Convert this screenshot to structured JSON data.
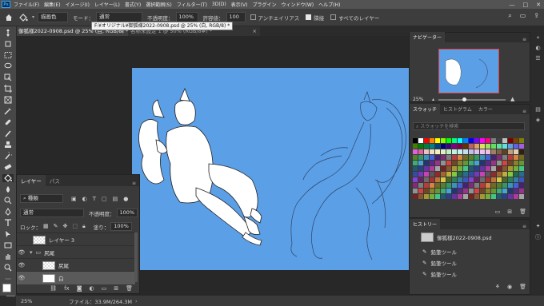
{
  "menu": {
    "app_badge": "Ps",
    "items": [
      "ファイル(F)",
      "編集(E)",
      "イメージ(I)",
      "レイヤー(L)",
      "書式(Y)",
      "選択範囲(S)",
      "フィルター(T)",
      "3D(D)",
      "表示(V)",
      "プラグイン",
      "ウィンドウ(W)",
      "ヘルプ(H)"
    ]
  },
  "options": {
    "fill_source": "描画色",
    "mode_label": "モード：",
    "mode_value": "通常",
    "opacity_label": "不透明度：",
    "opacity_value": "100%",
    "tolerance_label": "許容値：",
    "tolerance_value": "100",
    "antialias_label": "アンチエイリアス",
    "antialias_checked": false,
    "contiguous_label": "隣接",
    "contiguous_checked": true,
    "all_layers_label": "すべてのレイヤー",
    "all_layers_checked": false
  },
  "tabs": [
    {
      "label": "御狐様2022-0908.psd @ 25% (白, RGB/8) *",
      "active": true
    },
    {
      "label": "名称未設定 1 @ 50% (RGB/8#) *",
      "active": false
    }
  ],
  "tooltip": "F:¥オリジナル¥御狐様2022-0908.psd @ 25% (白, RGB/8) *",
  "layers_panel": {
    "tabs": [
      "レイヤー",
      "パス"
    ],
    "filter_label": "種類",
    "blend_mode": "通常",
    "opacity_label": "不透明度：",
    "opacity_value": "100%",
    "lock_label": "ロック：",
    "fill_label": "塗り：",
    "fill_value": "100%",
    "layers": [
      {
        "name": "レイヤー 3",
        "visible": false,
        "type": "layer",
        "indent": 0
      },
      {
        "name": "尻尾",
        "visible": true,
        "type": "group",
        "indent": 0
      },
      {
        "name": "尻尾",
        "visible": true,
        "type": "layer",
        "indent": 1
      },
      {
        "name": "白",
        "visible": true,
        "type": "layer",
        "indent": 1,
        "selected": true
      }
    ]
  },
  "navigator": {
    "title": "ナビゲーター",
    "zoom": "25%"
  },
  "swatches_panel": {
    "tabs": [
      "スウォッチ",
      "ヒストグラム",
      "カラー"
    ],
    "search_placeholder": "スウォッチを検索",
    "colors": [
      "#000000",
      "#ffffff",
      "#ff0000",
      "#ff8000",
      "#ffff00",
      "#80ff00",
      "#00ff00",
      "#00ff80",
      "#00ffff",
      "#0080ff",
      "#0000ff",
      "#8000ff",
      "#ff00ff",
      "#ff0080",
      "#808080",
      "#404040",
      "#c0c0c0",
      "#800000",
      "#804000",
      "#808000",
      "#408000",
      "#008000",
      "#008040",
      "#008080",
      "#004080",
      "#000080",
      "#400080",
      "#800080",
      "#800040",
      "#603000",
      "#c06060",
      "#e0a060",
      "#e0e060",
      "#a0e060",
      "#60e060",
      "#60e0a0",
      "#60e0e0",
      "#60a0e0",
      "#6060e0",
      "#a060e0",
      "#e060e0",
      "#e060a0",
      "#f0c0c0",
      "#f0e0c0",
      "#f0f0c0",
      "#e0f0c0",
      "#c0f0c0",
      "#c0f0e0",
      "#c0f0f0",
      "#c0e0f0",
      "#c0c0f0",
      "#e0c0f0",
      "#f0c0f0",
      "#f0c0e0",
      "#a08060",
      "#806040",
      "#604020",
      "#c0a080",
      "#e0d0b0",
      "#302010"
    ]
  },
  "history_panel": {
    "title": "ヒストリー",
    "items": [
      "御狐様2022-0908.psd",
      "鉛筆ツール",
      "鉛筆ツール",
      "鉛筆ツール"
    ]
  },
  "status": {
    "zoom": "25%",
    "file_info": "ファイル：33.9M/264.3M"
  }
}
